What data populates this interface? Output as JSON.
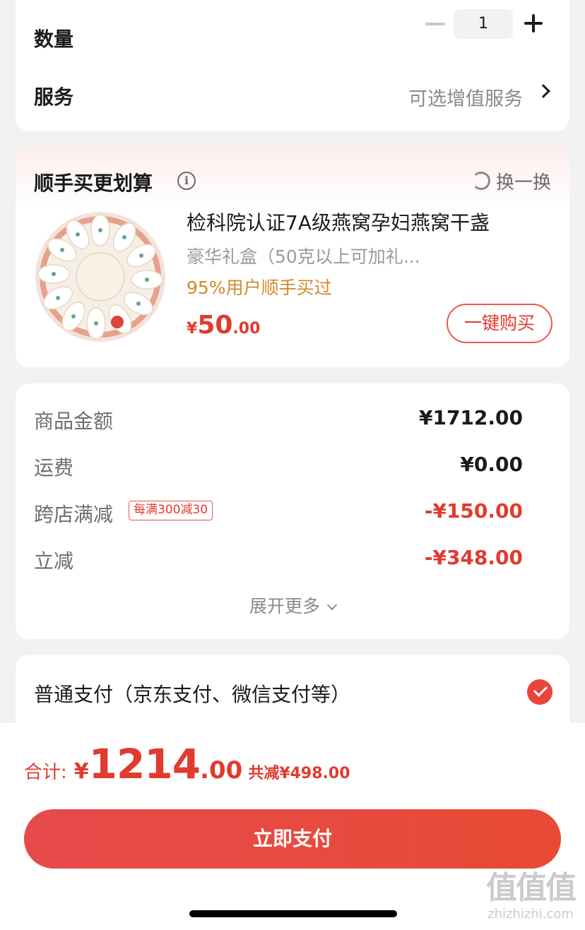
{
  "quantity": {
    "label": "数量",
    "value": "1"
  },
  "service": {
    "label": "服务",
    "value": "可选增值服务"
  },
  "addon": {
    "title": "顺手买更划算",
    "refresh_label": "换一换",
    "product": {
      "title": "检科院认证7A级燕窝孕妇燕窝干盏",
      "spec": "豪华礼盒（50克以上可加礼...",
      "stat": "95%用户顺手买过",
      "price_currency": "¥",
      "price_int": "50",
      "price_dec": ".00",
      "buy_label": "一键购买"
    }
  },
  "amounts": {
    "goods_label": "商品金额",
    "goods_value": "¥1712.00",
    "shipping_label": "运费",
    "shipping_value": "¥0.00",
    "cross_label": "跨店满减",
    "cross_tag": "每满300减30",
    "cross_value": "-¥150.00",
    "instant_label": "立减",
    "instant_value": "-¥348.00",
    "expand_label": "展开更多"
  },
  "payment": {
    "method_label": "普通支付（京东支付、微信支付等）"
  },
  "total": {
    "label": "合计:",
    "currency": "¥",
    "int": "1214",
    "dec": ".00",
    "saved": "共减¥498.00"
  },
  "pay_button": "立即支付",
  "watermark": {
    "logo": "值值值",
    "site": "zhizhizhi.com"
  },
  "colors": {
    "accent": "#e13a2f",
    "stat": "#d08a2a"
  }
}
